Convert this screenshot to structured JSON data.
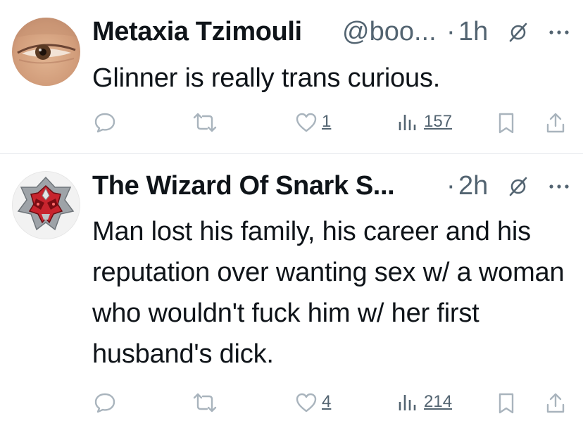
{
  "tweets": [
    {
      "author_name": "Metaxia Tzimouli",
      "handle": "@boo...",
      "separator": "·",
      "time": "1h",
      "text": "Glinner is really trans curious.",
      "stats": {
        "replies": "",
        "reposts": "",
        "likes": "1",
        "views": "157"
      },
      "avatar_icon": "eye-closeup-avatar"
    },
    {
      "author_name": "The Wizard Of Snark S...",
      "separator": "·",
      "time": "2h",
      "text": "Man lost his family, his career and his reputation over wanting sex w/ a woman who wouldn't fuck him w/ her first husband's dick.",
      "stats": {
        "replies": "",
        "reposts": "",
        "likes": "4",
        "views": "214"
      },
      "avatar_icon": "masked-helmet-avatar"
    }
  ],
  "icons": {
    "grok": "grok-icon",
    "more": "more-icon",
    "reply": "reply-icon",
    "repost": "repost-icon",
    "like": "like-icon",
    "views": "views-icon",
    "bookmark": "bookmark-icon",
    "share": "share-icon"
  },
  "colors": {
    "text_primary": "#0f1419",
    "text_secondary": "#536471",
    "icon": "#a9b4bd",
    "divider": "#e3e6ea",
    "background": "#ffffff"
  }
}
